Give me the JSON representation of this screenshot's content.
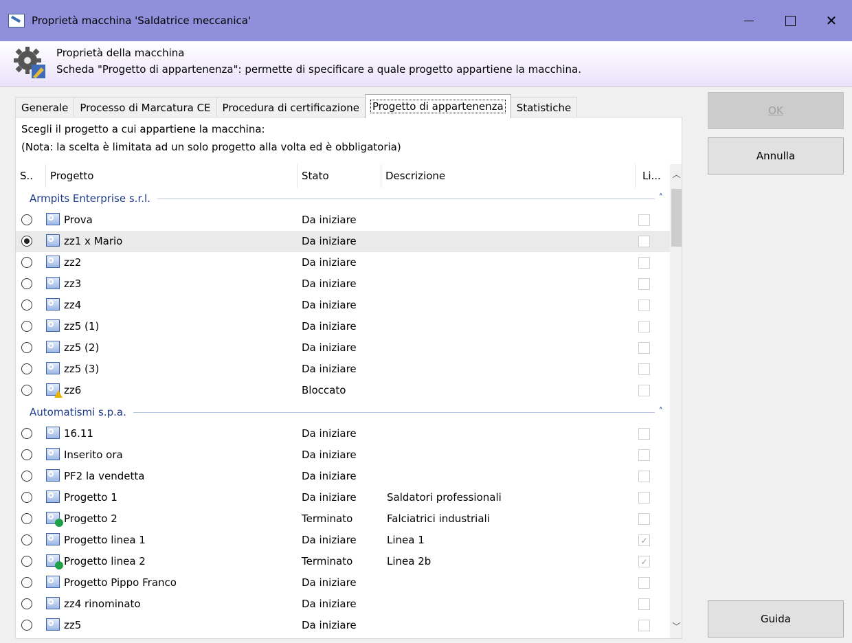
{
  "window": {
    "title": "Proprietà macchina 'Saldatrice meccanica'"
  },
  "window_controls": {
    "minimize": "—",
    "maximize": "☐",
    "close": "✕"
  },
  "banner": {
    "title": "Proprietà della macchina",
    "subtitle": "Scheda \"Progetto di appartenenza\": permette di specificare a quale progetto appartiene la macchina."
  },
  "tabs": [
    {
      "label": "Generale"
    },
    {
      "label": "Processo di Marcatura CE"
    },
    {
      "label": "Procedura di certificazione"
    },
    {
      "label": "Progetto di appartenenza",
      "active": true
    },
    {
      "label": "Statistiche"
    }
  ],
  "panel": {
    "instruction1": "Scegli il progetto a cui appartiene la macchina:",
    "instruction2": "(Nota: la scelta è limitata ad un solo progetto alla volta ed è obbligatoria)"
  },
  "columns": {
    "sel": "S..",
    "progetto": "Progetto",
    "stato": "Stato",
    "descrizione": "Descrizione",
    "li": "Li..."
  },
  "groups": [
    {
      "name": "Armpits Enterprise s.r.l.",
      "rows": [
        {
          "name": "Prova",
          "stato": "Da iniziare",
          "desc": "",
          "checked": false,
          "selected": false,
          "icon": "project-icon"
        },
        {
          "name": "zz1 x Mario",
          "stato": "Da iniziare",
          "desc": "",
          "checked": false,
          "selected": true,
          "icon": "project-icon"
        },
        {
          "name": "zz2",
          "stato": "Da iniziare",
          "desc": "",
          "checked": false,
          "selected": false,
          "icon": "project-icon"
        },
        {
          "name": "zz3",
          "stato": "Da iniziare",
          "desc": "",
          "checked": false,
          "selected": false,
          "icon": "project-icon"
        },
        {
          "name": "zz4",
          "stato": "Da iniziare",
          "desc": "",
          "checked": false,
          "selected": false,
          "icon": "project-icon"
        },
        {
          "name": "zz5 (1)",
          "stato": "Da iniziare",
          "desc": "",
          "checked": false,
          "selected": false,
          "icon": "project-icon"
        },
        {
          "name": "zz5 (2)",
          "stato": "Da iniziare",
          "desc": "",
          "checked": false,
          "selected": false,
          "icon": "project-icon"
        },
        {
          "name": "zz5 (3)",
          "stato": "Da iniziare",
          "desc": "",
          "checked": false,
          "selected": false,
          "icon": "project-icon"
        },
        {
          "name": "zz6",
          "stato": "Bloccato",
          "desc": "",
          "checked": false,
          "selected": false,
          "icon": "project-warning-icon"
        }
      ]
    },
    {
      "name": "Automatismi s.p.a.",
      "rows": [
        {
          "name": "16.11",
          "stato": "Da iniziare",
          "desc": "",
          "checked": false,
          "selected": false,
          "icon": "project-icon"
        },
        {
          "name": "Inserito ora",
          "stato": "Da iniziare",
          "desc": "",
          "checked": false,
          "selected": false,
          "icon": "project-icon"
        },
        {
          "name": "PF2 la vendetta",
          "stato": "Da iniziare",
          "desc": "",
          "checked": false,
          "selected": false,
          "icon": "project-icon"
        },
        {
          "name": "Progetto 1",
          "stato": "Da iniziare",
          "desc": "Saldatori professionali",
          "checked": false,
          "selected": false,
          "icon": "project-icon"
        },
        {
          "name": "Progetto 2",
          "stato": "Terminato",
          "desc": "Falciatrici industriali",
          "checked": false,
          "selected": false,
          "icon": "project-done-icon"
        },
        {
          "name": "Progetto linea 1",
          "stato": "Da iniziare",
          "desc": "Linea 1",
          "checked": true,
          "selected": false,
          "icon": "project-icon"
        },
        {
          "name": "Progetto linea 2",
          "stato": "Terminato",
          "desc": "Linea 2b",
          "checked": true,
          "selected": false,
          "icon": "project-done-icon"
        },
        {
          "name": "Progetto Pippo Franco",
          "stato": "Da iniziare",
          "desc": "",
          "checked": false,
          "selected": false,
          "icon": "project-icon"
        },
        {
          "name": "zz4 rinominato",
          "stato": "Da iniziare",
          "desc": "",
          "checked": false,
          "selected": false,
          "icon": "project-icon"
        },
        {
          "name": "zz5",
          "stato": "Da iniziare",
          "desc": "",
          "checked": false,
          "selected": false,
          "icon": "project-icon"
        }
      ]
    }
  ],
  "buttons": {
    "ok": "OK",
    "annulla": "Annulla",
    "guida": "Guida"
  }
}
